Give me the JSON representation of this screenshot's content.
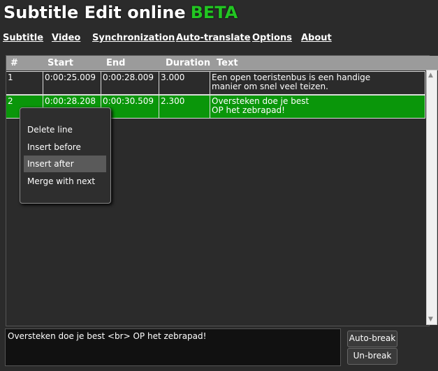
{
  "header": {
    "title": "Subtitle Edit online",
    "beta": "BETA"
  },
  "menu": [
    "Subtitle",
    "Video",
    "Synchronization",
    "Auto-translate",
    "Options",
    "About"
  ],
  "columns": [
    "#",
    "Start",
    "End",
    "Duration",
    "Text"
  ],
  "rows": [
    {
      "num": "1",
      "start": "0:00:25.009",
      "end": "0:00:28.009",
      "duration": "3.000",
      "text1": "Een open toeristenbus is een handige",
      "text2": "manier om snel veel teizen."
    },
    {
      "num": "2",
      "start": "0:00:28.208",
      "end": "0:00:30.509",
      "duration": "2.300",
      "text1": "Oversteken doe je best",
      "text2": "OP het zebrapad!"
    }
  ],
  "context_menu": [
    "Delete line",
    "Insert before",
    "Insert after",
    "Merge with next"
  ],
  "editor": {
    "value": "Oversteken doe je best <br> OP het zebrapad!"
  },
  "buttons": {
    "auto_break": "Auto-break",
    "un_break": "Un-break"
  },
  "colors": {
    "accent": "#22c522",
    "selected_row": "#0a960a"
  }
}
